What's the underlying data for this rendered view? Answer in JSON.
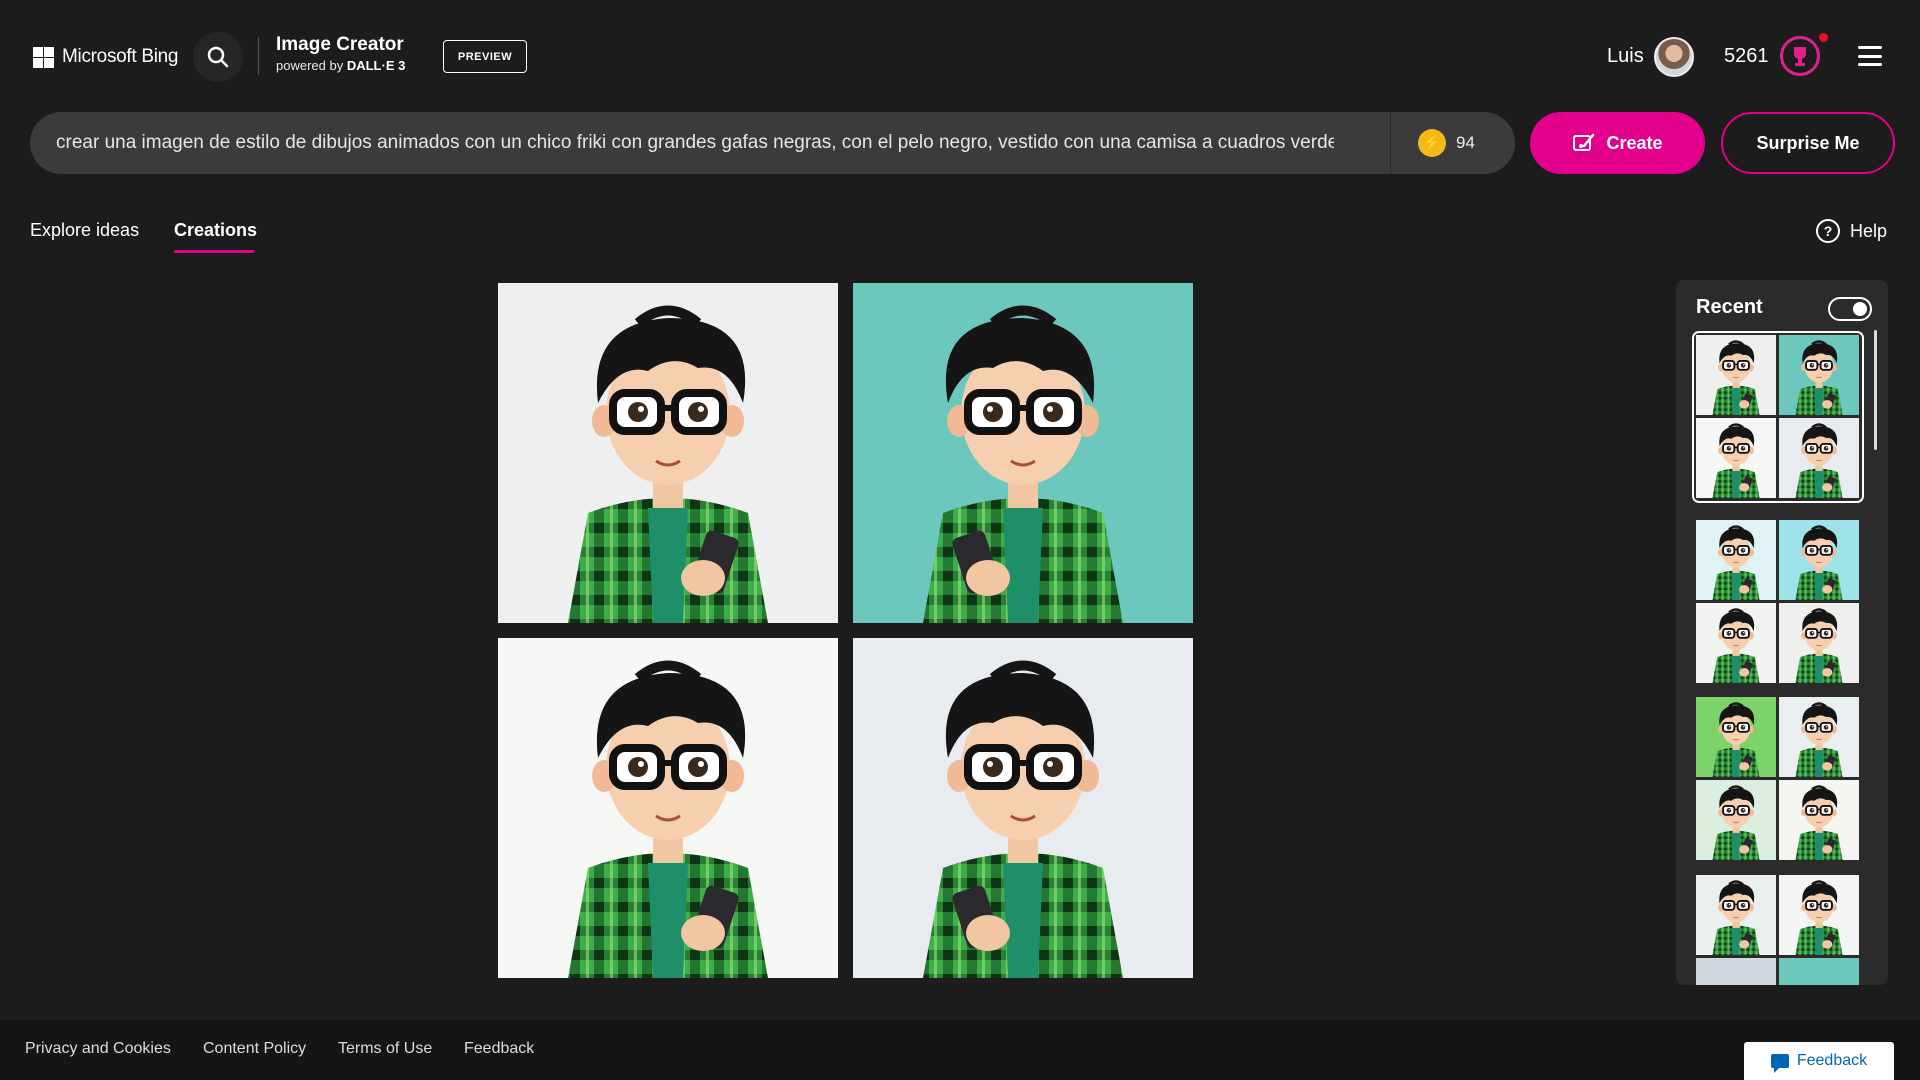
{
  "header": {
    "brand": "Microsoft Bing",
    "product_title": "Image Creator",
    "powered_prefix": "powered by ",
    "powered_model": "DALL·E 3",
    "preview_badge": "PREVIEW",
    "user_name": "Luis",
    "points": "5261"
  },
  "prompt": {
    "text": "crear una imagen de estilo de dibujos animados con un chico friki con grandes gafas negras, con el pelo negro, vestido con una camisa a cuadros verde y sosteniendo un teléfono móvil",
    "boosts": "94",
    "create_label": "Create",
    "surprise_label": "Surprise Me"
  },
  "tabs": {
    "explore": "Explore ideas",
    "creations": "Creations",
    "help": "Help"
  },
  "recent": {
    "title": "Recent",
    "toggle_on": true
  },
  "footer": {
    "links": [
      "Privacy and Cookies",
      "Content Policy",
      "Terms of Use",
      "Feedback"
    ],
    "feedback_button": "Feedback"
  },
  "colors": {
    "accent": "#e3008c",
    "background": "#1c1c1c",
    "prompt_bg": "#3b3b3b",
    "boost_coin": "#f5b916"
  },
  "icons": [
    "windows-logo-icon",
    "search-icon",
    "rewards-trophy-icon",
    "menu-icon",
    "boost-bolt-icon",
    "create-brush-icon",
    "help-icon",
    "feedback-chat-icon"
  ]
}
